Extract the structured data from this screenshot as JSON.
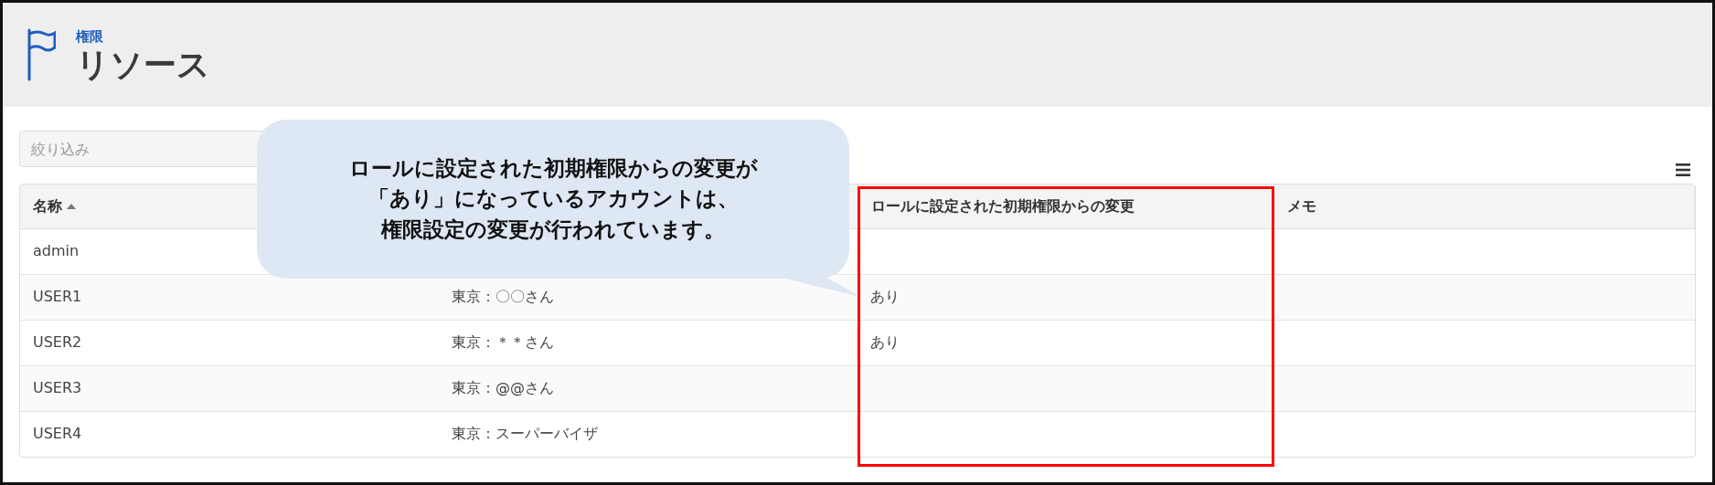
{
  "header": {
    "breadcrumb": "権限",
    "title": "リソース"
  },
  "filter": {
    "placeholder": "絞り込み"
  },
  "table": {
    "columns": [
      {
        "label": "名称",
        "sorted": true,
        "highlighted": false
      },
      {
        "sorted": false,
        "highlighted": false
      },
      {
        "label": "ロールに設定された初期権限からの変更",
        "sorted": false,
        "highlighted": true
      },
      {
        "label": "メモ",
        "sorted": false,
        "highlighted": false
      }
    ],
    "rows": [
      {
        "cells": [
          "admin",
          "",
          "",
          ""
        ]
      },
      {
        "cells": [
          "USER1",
          "東京：〇〇さん",
          "あり",
          ""
        ]
      },
      {
        "cells": [
          "USER2",
          "東京：＊＊さん",
          "あり",
          ""
        ]
      },
      {
        "cells": [
          "USER3",
          "東京：@@さん",
          "",
          ""
        ]
      },
      {
        "cells": [
          "USER4",
          "東京：スーパーバイザ",
          "",
          ""
        ]
      }
    ]
  },
  "callout": {
    "lines": [
      "ロールに設定された初期権限からの変更が",
      "「あり」になっているアカウントは、",
      "権限設定の変更が行われています。"
    ]
  }
}
